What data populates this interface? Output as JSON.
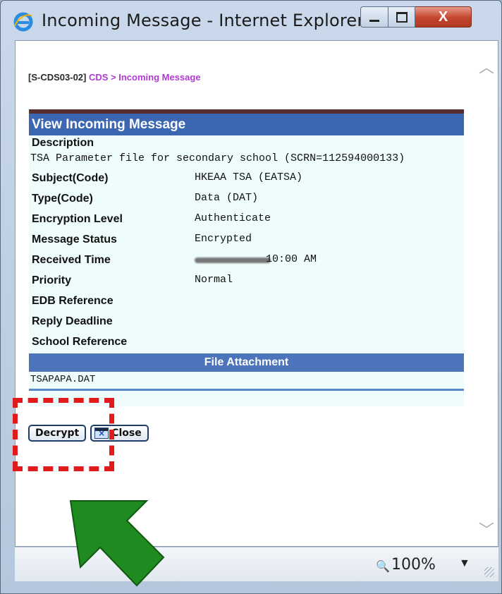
{
  "window": {
    "title": "Incoming Message - Internet Explorer",
    "controls": {
      "minimize": "—",
      "maximize": "□",
      "close": "X"
    }
  },
  "breadcrumb": {
    "code": "[S-CDS03-02]",
    "path": "CDS > Incoming Message"
  },
  "panel": {
    "title": "View Incoming Message",
    "description_label": "Description",
    "description_value": "TSA Parameter file for secondary school (SCRN=112594000133)",
    "fields": [
      {
        "label": "Subject(Code)",
        "value": "HKEAA TSA (EATSA)"
      },
      {
        "label": "Type(Code)",
        "value": "Data (DAT)"
      },
      {
        "label": "Encryption Level",
        "value": "Authenticate"
      },
      {
        "label": "Message Status",
        "value": "Encrypted"
      },
      {
        "label": "Received Time",
        "value": "10:00 AM"
      },
      {
        "label": "Priority",
        "value": "Normal"
      },
      {
        "label": "EDB Reference",
        "value": ""
      },
      {
        "label": "Reply Deadline",
        "value": ""
      },
      {
        "label": "School Reference",
        "value": ""
      }
    ],
    "file_section_title": "File Attachment",
    "file_name": "TSAPAPA.DAT"
  },
  "buttons": {
    "decrypt": "Decrypt",
    "close": "Close"
  },
  "statusbar": {
    "zoom": "100%"
  },
  "colors": {
    "panel_header": "#3b67b2",
    "highlight_box": "#e11b1b",
    "arrow": "#1f8a1f"
  }
}
